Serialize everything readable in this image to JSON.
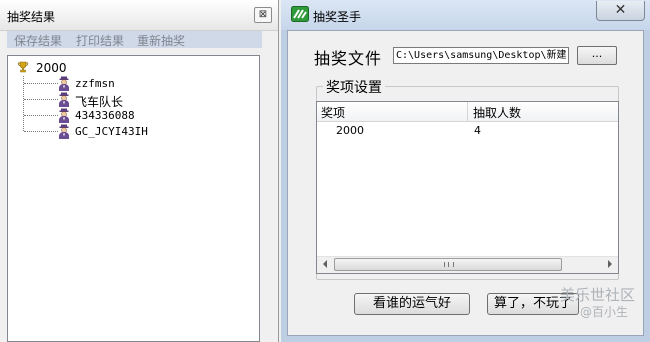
{
  "results_window": {
    "title": "抽奖结果",
    "close_glyph": "⊠",
    "menu": [
      "保存结果",
      "打印结果",
      "重新抽奖"
    ],
    "tree": {
      "root": {
        "icon": "trophy-icon",
        "label": "2000"
      },
      "children": [
        {
          "icon": "person-icon",
          "label": "zzfmsn"
        },
        {
          "icon": "person-icon",
          "label": "飞车队长"
        },
        {
          "icon": "person-icon",
          "label": "434336088"
        },
        {
          "icon": "person-icon",
          "label": "GC_JCYI43IH"
        }
      ]
    }
  },
  "main_window": {
    "title": "抽奖圣手",
    "icon": "app-icon",
    "close_glyph": "✕",
    "file_label": "抽奖文件",
    "file_path": "C:\\Users\\samsung\\Desktop\\新建",
    "browse_label": "...",
    "group_title": "奖项设置",
    "columns": [
      "奖项",
      "抽取人数"
    ],
    "rows": [
      {
        "prize": "2000",
        "count": "4"
      }
    ],
    "buttons": {
      "lucky": "看谁的运气好",
      "quit": "算了，不玩了"
    }
  },
  "watermark": {
    "line1": "美乐世社区",
    "line2": "@百小生"
  },
  "colors": {
    "window_frame": "#bfcfe3",
    "menubar": "#cfd9e8",
    "background": "#f0f0f0"
  }
}
